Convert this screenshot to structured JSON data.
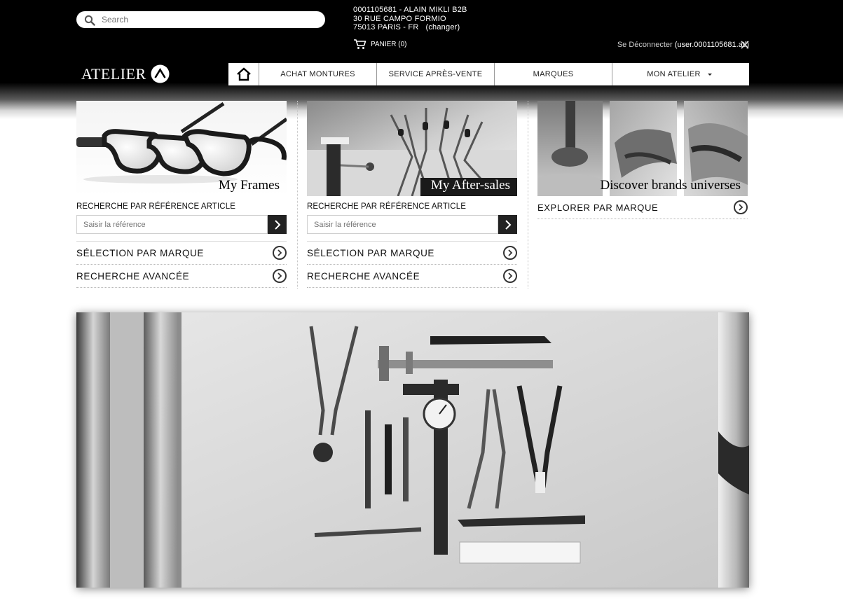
{
  "search": {
    "placeholder": "Search"
  },
  "account": {
    "line1": "0001105681 - ALAIN MIKLI B2B",
    "line2": "30 RUE CAMPO FORMIO",
    "line3": "75013 PARIS - FR",
    "change_label": "(changer)"
  },
  "cart": {
    "label": "PANIER (0)"
  },
  "logout": {
    "label": "Se Déconnecter",
    "user": "(user.0001105681.atl)"
  },
  "logo": {
    "text": "ATELIER"
  },
  "nav": {
    "items": [
      {
        "label": "ACHAT MONTURES"
      },
      {
        "label": "SERVICE APRÈS-VENTE"
      },
      {
        "label": "MARQUES"
      },
      {
        "label": "MON ATELIER"
      }
    ]
  },
  "columns": [
    {
      "caption": "My Frames",
      "search_label": "RECHERCHE PAR RÉFÉRENCE ARTICLE",
      "input_placeholder": "Saisir la référence",
      "link1": "SÉLECTION PAR MARQUE",
      "link2": "RECHERCHE AVANCÉE"
    },
    {
      "caption": "My After-sales",
      "search_label": "RECHERCHE PAR RÉFÉRENCE ARTICLE",
      "input_placeholder": "Saisir la référence",
      "link1": "SÉLECTION PAR MARQUE",
      "link2": "RECHERCHE AVANCÉE"
    },
    {
      "caption": "Discover brands universes",
      "link1": "EXPLORER PAR MARQUE"
    }
  ],
  "colors": {
    "black": "#000000",
    "white": "#ffffff",
    "grey_rule": "#b8b8b8"
  }
}
